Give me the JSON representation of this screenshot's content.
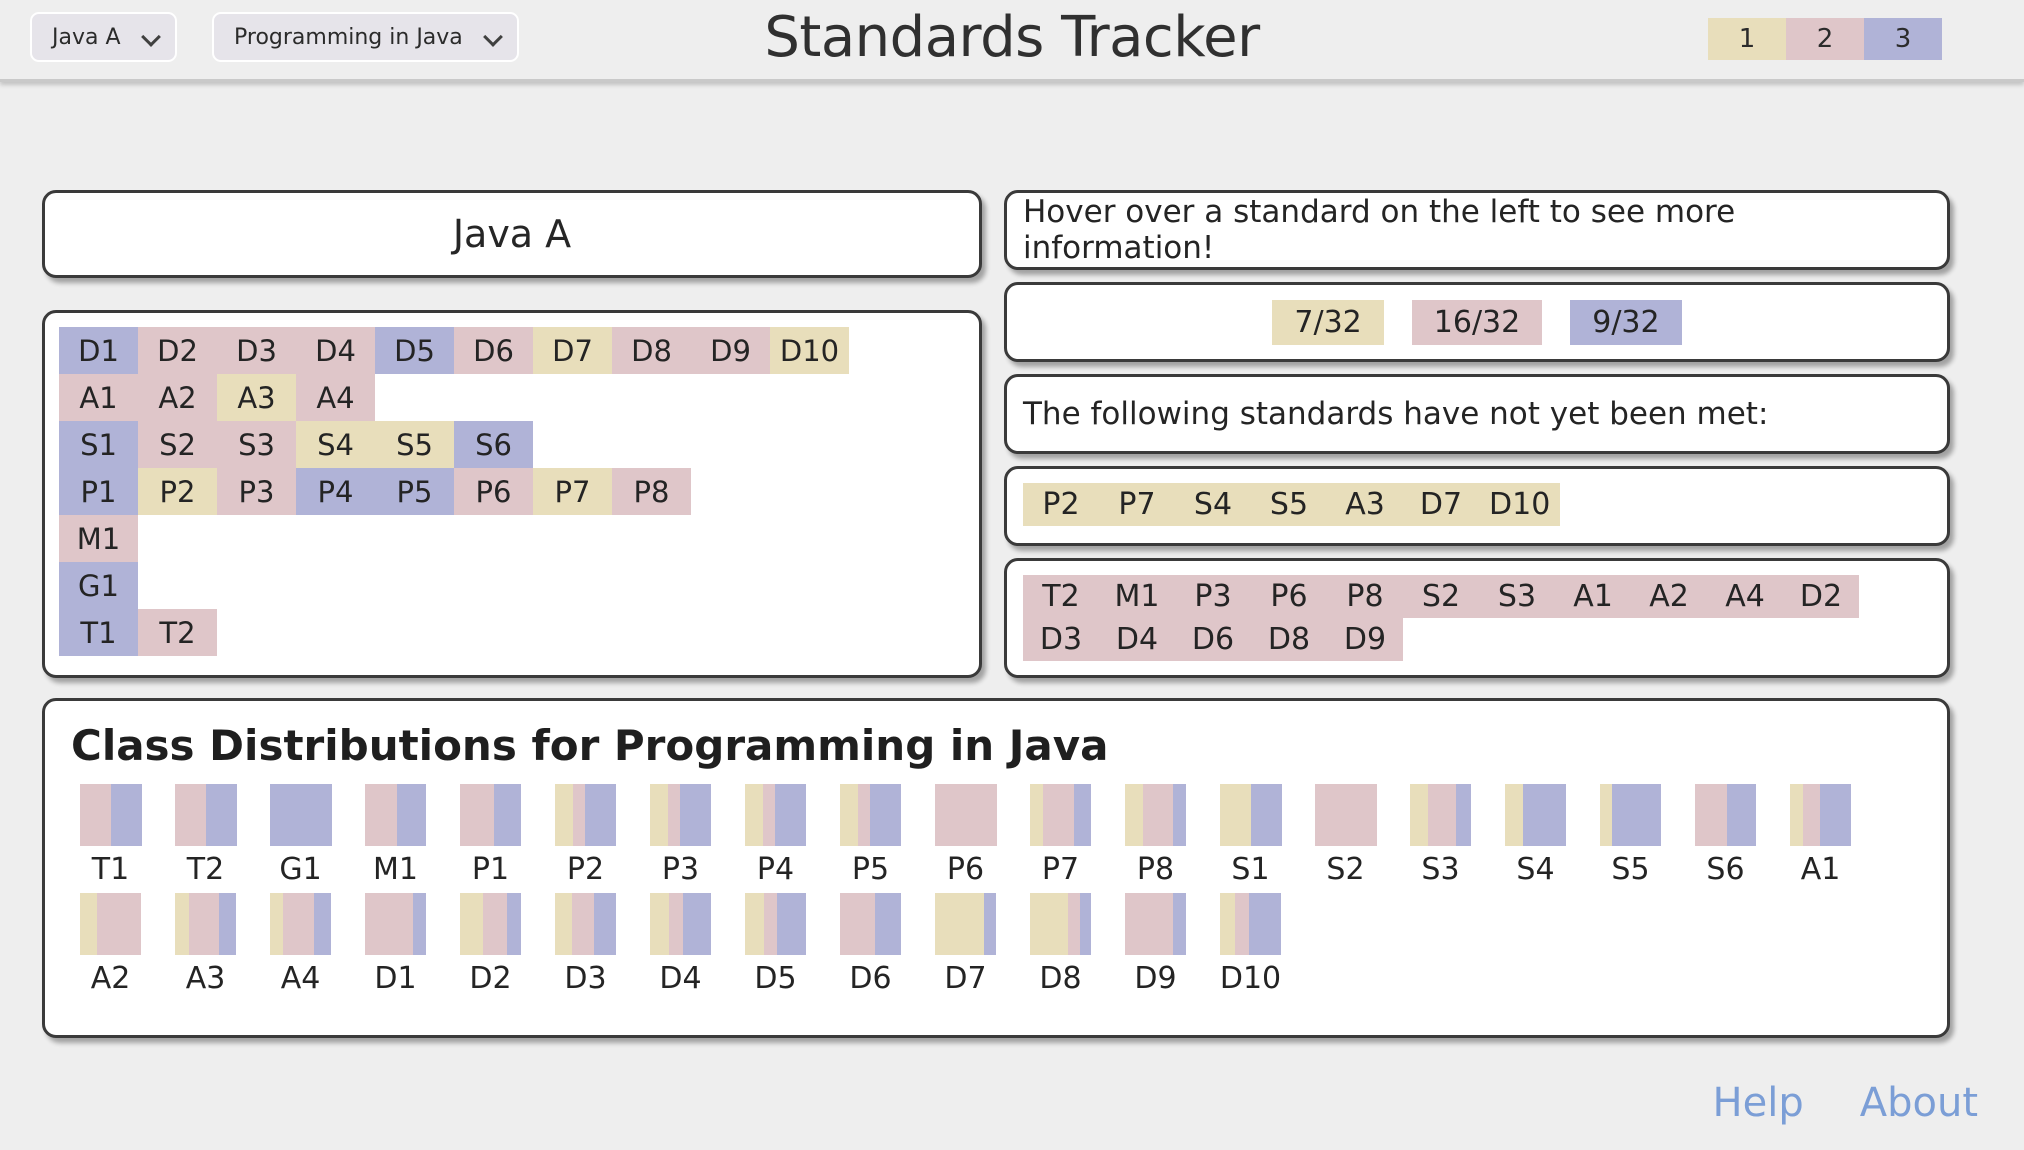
{
  "header": {
    "title": "Standards Tracker",
    "class_select": {
      "value": "Java A",
      "icon": "chevron-down-icon"
    },
    "course_select": {
      "value": "Programming in Java",
      "icon": "chevron-down-icon"
    },
    "legend": [
      {
        "label": "1",
        "color": "#e8debb"
      },
      {
        "label": "2",
        "color": "#dfc6c9"
      },
      {
        "label": "3",
        "color": "#b0b3d7"
      }
    ]
  },
  "class_card": {
    "title": "Java A"
  },
  "standards_grid": {
    "rows": [
      [
        {
          "label": "D1",
          "level": 3
        },
        {
          "label": "D2",
          "level": 2
        },
        {
          "label": "D3",
          "level": 2
        },
        {
          "label": "D4",
          "level": 2
        },
        {
          "label": "D5",
          "level": 3
        },
        {
          "label": "D6",
          "level": 2
        },
        {
          "label": "D7",
          "level": 1
        },
        {
          "label": "D8",
          "level": 2
        },
        {
          "label": "D9",
          "level": 2
        },
        {
          "label": "D10",
          "level": 1
        }
      ],
      [
        {
          "label": "A1",
          "level": 2
        },
        {
          "label": "A2",
          "level": 2
        },
        {
          "label": "A3",
          "level": 1
        },
        {
          "label": "A4",
          "level": 2
        }
      ],
      [
        {
          "label": "S1",
          "level": 3
        },
        {
          "label": "S2",
          "level": 2
        },
        {
          "label": "S3",
          "level": 2
        },
        {
          "label": "S4",
          "level": 1
        },
        {
          "label": "S5",
          "level": 1
        },
        {
          "label": "S6",
          "level": 3
        }
      ],
      [
        {
          "label": "P1",
          "level": 3
        },
        {
          "label": "P2",
          "level": 1
        },
        {
          "label": "P3",
          "level": 2
        },
        {
          "label": "P4",
          "level": 3
        },
        {
          "label": "P5",
          "level": 3
        },
        {
          "label": "P6",
          "level": 2
        },
        {
          "label": "P7",
          "level": 1
        },
        {
          "label": "P8",
          "level": 2
        }
      ],
      [
        {
          "label": "M1",
          "level": 2
        }
      ],
      [
        {
          "label": "G1",
          "level": 3
        }
      ],
      [
        {
          "label": "T1",
          "level": 3
        },
        {
          "label": "T2",
          "level": 2
        }
      ]
    ]
  },
  "info": {
    "hover_message": "Hover over a standard on the left to see more information!",
    "counts": [
      {
        "text": "7/32",
        "level": 1
      },
      {
        "text": "16/32",
        "level": 2
      },
      {
        "text": "9/32",
        "level": 3
      }
    ],
    "not_met_heading": "The following standards have not yet been met:",
    "not_met_level1": [
      "P2",
      "P7",
      "S4",
      "S5",
      "A3",
      "D7",
      "D10"
    ],
    "not_met_level2": [
      "T2",
      "M1",
      "P3",
      "P6",
      "P8",
      "S2",
      "S3",
      "A1",
      "A2",
      "A4",
      "D2",
      "D3",
      "D4",
      "D6",
      "D8",
      "D9"
    ]
  },
  "distributions": {
    "title": "Class Distributions for Programming in Java"
  },
  "footer": {
    "links": [
      "Help",
      "About"
    ]
  },
  "chart_data": {
    "type": "bar",
    "title": "Class Distributions for Programming in Java",
    "subtitle": "",
    "xlabel": "",
    "ylabel": "",
    "stacked": true,
    "orientation": "vertical",
    "normalized": true,
    "legend_position": "top-right",
    "series": [
      {
        "name": "1",
        "color": "#e8debb"
      },
      {
        "name": "2",
        "color": "#dfc6c9"
      },
      {
        "name": "3",
        "color": "#b0b3d7"
      }
    ],
    "categories": [
      "T1",
      "T2",
      "G1",
      "M1",
      "P1",
      "P2",
      "P3",
      "P4",
      "P5",
      "P6",
      "P7",
      "P8",
      "S1",
      "S2",
      "S3",
      "S4",
      "S5",
      "S6",
      "A1",
      "A2",
      "A3",
      "A4",
      "D1",
      "D2",
      "D3",
      "D4",
      "D5",
      "D6",
      "D7",
      "D8",
      "D9",
      "D10"
    ],
    "values": [
      {
        "category": "T1",
        "level1": 0.0,
        "level2": 0.5,
        "level3": 0.5
      },
      {
        "category": "T2",
        "level1": 0.0,
        "level2": 0.5,
        "level3": 0.5
      },
      {
        "category": "G1",
        "level1": 0.0,
        "level2": 0.0,
        "level3": 1.0
      },
      {
        "category": "M1",
        "level1": 0.0,
        "level2": 0.52,
        "level3": 0.48
      },
      {
        "category": "P1",
        "level1": 0.0,
        "level2": 0.55,
        "level3": 0.45
      },
      {
        "category": "P2",
        "level1": 0.3,
        "level2": 0.2,
        "level3": 0.5
      },
      {
        "category": "P3",
        "level1": 0.3,
        "level2": 0.2,
        "level3": 0.5
      },
      {
        "category": "P4",
        "level1": 0.3,
        "level2": 0.2,
        "level3": 0.5
      },
      {
        "category": "P5",
        "level1": 0.3,
        "level2": 0.2,
        "level3": 0.5
      },
      {
        "category": "P6",
        "level1": 0.0,
        "level2": 1.0,
        "level3": 0.0
      },
      {
        "category": "P7",
        "level1": 0.22,
        "level2": 0.5,
        "level3": 0.28
      },
      {
        "category": "P8",
        "level1": 0.3,
        "level2": 0.48,
        "level3": 0.22
      },
      {
        "category": "S1",
        "level1": 0.5,
        "level2": 0.0,
        "level3": 0.5
      },
      {
        "category": "S2",
        "level1": 0.0,
        "level2": 1.0,
        "level3": 0.0
      },
      {
        "category": "S3",
        "level1": 0.3,
        "level2": 0.45,
        "level3": 0.25
      },
      {
        "category": "S4",
        "level1": 0.3,
        "level2": 0.0,
        "level3": 0.7
      },
      {
        "category": "S5",
        "level1": 0.2,
        "level2": 0.0,
        "level3": 0.8
      },
      {
        "category": "S6",
        "level1": 0.0,
        "level2": 0.52,
        "level3": 0.48
      },
      {
        "category": "A1",
        "level1": 0.22,
        "level2": 0.28,
        "level3": 0.5
      },
      {
        "category": "A2",
        "level1": 0.28,
        "level2": 0.72,
        "level3": 0.0
      },
      {
        "category": "A3",
        "level1": 0.24,
        "level2": 0.48,
        "level3": 0.28
      },
      {
        "category": "A4",
        "level1": 0.22,
        "level2": 0.5,
        "level3": 0.28
      },
      {
        "category": "D1",
        "level1": 0.0,
        "level2": 0.78,
        "level3": 0.22
      },
      {
        "category": "D2",
        "level1": 0.38,
        "level2": 0.38,
        "level3": 0.24
      },
      {
        "category": "D3",
        "level1": 0.28,
        "level2": 0.35,
        "level3": 0.37
      },
      {
        "category": "D4",
        "level1": 0.32,
        "level2": 0.22,
        "level3": 0.46
      },
      {
        "category": "D5",
        "level1": 0.32,
        "level2": 0.2,
        "level3": 0.48
      },
      {
        "category": "D6",
        "level1": 0.0,
        "level2": 0.58,
        "level3": 0.42
      },
      {
        "category": "D7",
        "level1": 0.8,
        "level2": 0.0,
        "level3": 0.2
      },
      {
        "category": "D8",
        "level1": 0.62,
        "level2": 0.2,
        "level3": 0.18
      },
      {
        "category": "D9",
        "level1": 0.0,
        "level2": 0.78,
        "level3": 0.22
      },
      {
        "category": "D10",
        "level1": 0.25,
        "level2": 0.22,
        "level3": 0.53
      }
    ],
    "row_split": 19
  }
}
